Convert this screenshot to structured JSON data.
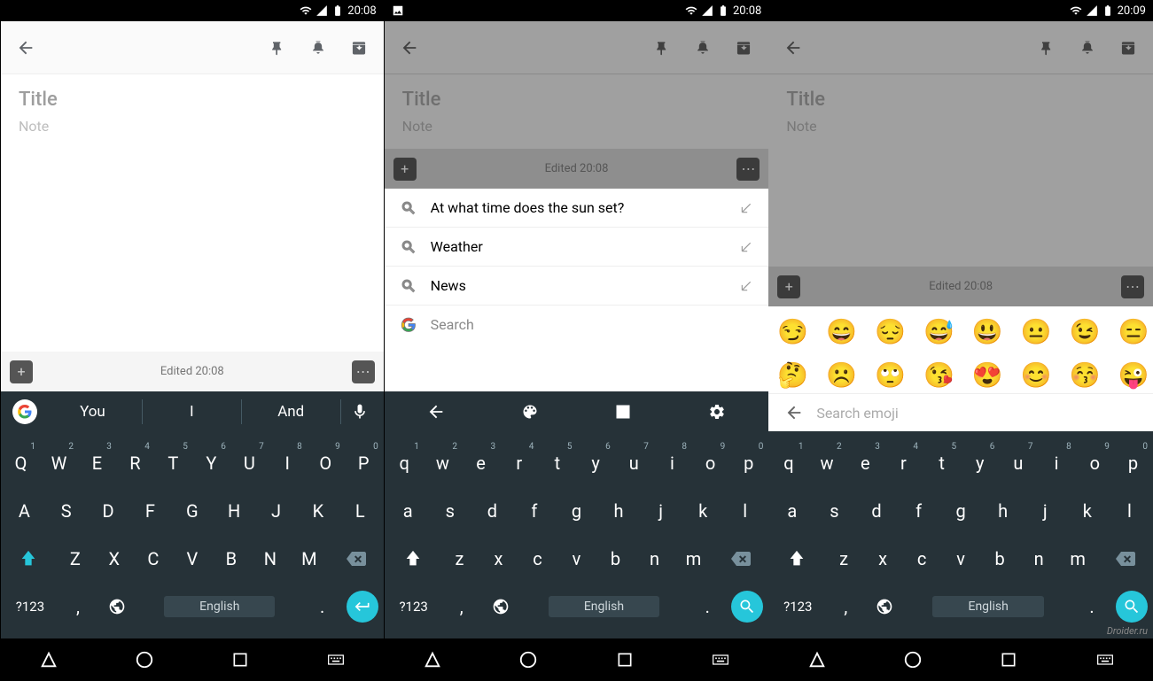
{
  "status": {
    "time1": "20:08",
    "time2": "20:08",
    "time3": "20:09"
  },
  "app": {
    "title_ph": "Title",
    "note_ph": "Note",
    "edited": "Edited 20:08"
  },
  "sugg1": {
    "a": "You",
    "b": "I",
    "c": "And"
  },
  "search": {
    "q1": "At what time does the sun set?",
    "q2": "Weather",
    "q3": "News",
    "ph": "Search"
  },
  "emoji": {
    "row1": [
      "😏",
      "😄",
      "😔",
      "😅",
      "😃",
      "😐",
      "😉",
      "😑"
    ],
    "row2": [
      "🤔",
      "☹️",
      "🙄",
      "😘",
      "😍",
      "😊",
      "😚",
      "😜"
    ],
    "search_ph": "Search emoji"
  },
  "kb": {
    "row1": [
      "q",
      "w",
      "e",
      "r",
      "t",
      "y",
      "u",
      "i",
      "o",
      "p"
    ],
    "nums": [
      "1",
      "2",
      "3",
      "4",
      "5",
      "6",
      "7",
      "8",
      "9",
      "0"
    ],
    "row2": [
      "a",
      "s",
      "d",
      "f",
      "g",
      "h",
      "j",
      "k",
      "l"
    ],
    "row3": [
      "z",
      "x",
      "c",
      "v",
      "b",
      "n",
      "m"
    ],
    "sym": "?123",
    "lang": "English",
    "comma": ",",
    "dot": "."
  },
  "watermark": "Droider.ru"
}
